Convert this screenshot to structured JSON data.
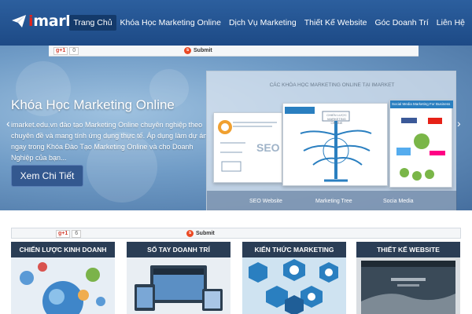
{
  "header": {
    "logo_first_letter": "i",
    "logo_rest": "market",
    "nav": [
      {
        "label": "Trang Chủ",
        "active": true
      },
      {
        "label": "Khóa Học Marketing Online"
      },
      {
        "label": "Dịch Vụ Marketing"
      },
      {
        "label": "Thiết Kế Website"
      },
      {
        "label": "Góc Doanh Trí"
      },
      {
        "label": "Liên Hệ"
      }
    ]
  },
  "share": {
    "gplus_label": "g+1",
    "gplus_count_top": "0",
    "gplus_count_bottom": "6",
    "submit_label": "Submit"
  },
  "hero": {
    "title": "Khóa Học Marketing Online",
    "description": "imarket.edu.vn đào tạo Marketing Online chuyên nghiệp theo chuyên đề và mang tính ứng dụng thực tế. Áp dụng làm dự án ngay trong Khóa Đào Tạo Marketing Online và cho Doanh Nghiệp của bạn...",
    "button": "Xem Chi Tiết",
    "prev_arrow": "‹",
    "next_arrow": "›",
    "showcase": {
      "title": "CÁC KHÓA HỌC MARKETING ONLINE TẠI IMARKET",
      "card_labels": {
        "seo": "SEO",
        "center": "CHIẾN LƯỢC MARKETING ONLINE",
        "social": "Social Media Marketing For Business"
      },
      "captions": [
        "SEO Website",
        "Marketing Tree",
        "Socia Media"
      ]
    }
  },
  "tiles": [
    {
      "title": "CHIẾN LƯỢC KINH DOANH"
    },
    {
      "title": "SỔ TAY DOANH TRÍ"
    },
    {
      "title": "KIẾN THỨC MARKETING ONLINE"
    },
    {
      "title": "THIẾT KẾ WEBSITE"
    }
  ],
  "colors": {
    "header": "#1d4a86",
    "accent_red": "#e2231a",
    "tile_head": "#2a3d55"
  }
}
